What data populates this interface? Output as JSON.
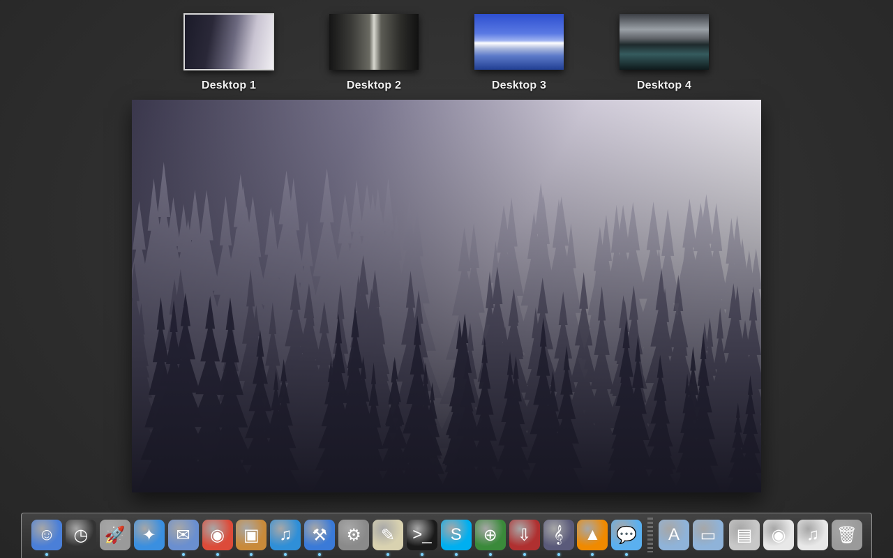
{
  "spaces": [
    {
      "label": "Desktop 1",
      "scene": "forest",
      "active": true
    },
    {
      "label": "Desktop 2",
      "scene": "canyon",
      "active": false
    },
    {
      "label": "Desktop 3",
      "scene": "glacier",
      "active": false
    },
    {
      "label": "Desktop 4",
      "scene": "mountain",
      "active": false
    }
  ],
  "dock": {
    "apps": [
      {
        "name": "finder-icon",
        "glyph": "☺",
        "color": "#4a7fd8",
        "running": true
      },
      {
        "name": "dashboard-icon",
        "glyph": "◷",
        "color": "#333333",
        "running": false
      },
      {
        "name": "launchpad-icon",
        "glyph": "🚀",
        "color": "#9a9a9a",
        "running": false
      },
      {
        "name": "safari-icon",
        "glyph": "✦",
        "color": "#3a8fe0",
        "running": false
      },
      {
        "name": "mail-icon",
        "glyph": "✉",
        "color": "#6a8fd0",
        "running": true
      },
      {
        "name": "chrome-icon",
        "glyph": "◉",
        "color": "#dd4b39",
        "running": true
      },
      {
        "name": "preview-icon",
        "glyph": "▣",
        "color": "#c98a3a",
        "running": true
      },
      {
        "name": "itunes-icon",
        "glyph": "♫",
        "color": "#2f8fd8",
        "running": true
      },
      {
        "name": "xcode-icon",
        "glyph": "⚒",
        "color": "#3a7ad8",
        "running": true
      },
      {
        "name": "system-preferences-icon",
        "glyph": "⚙",
        "color": "#8a8a8a",
        "running": false
      },
      {
        "name": "textedit-icon",
        "glyph": "✎",
        "color": "#d9d2b0",
        "running": true
      },
      {
        "name": "terminal-icon",
        "glyph": ">_",
        "color": "#1a1a1a",
        "running": true
      },
      {
        "name": "skype-icon",
        "glyph": "S",
        "color": "#00aff0",
        "running": true
      },
      {
        "name": "network-globe-icon",
        "glyph": "⊕",
        "color": "#3a8a3a",
        "running": true
      },
      {
        "name": "installer-icon",
        "glyph": "⇩",
        "color": "#b03030",
        "running": true
      },
      {
        "name": "sheet-music-icon",
        "glyph": "𝄞",
        "color": "#5a5a7a",
        "running": true
      },
      {
        "name": "vlc-icon",
        "glyph": "▲",
        "color": "#f08a00",
        "running": true
      },
      {
        "name": "messages-icon",
        "glyph": "💬",
        "color": "#5ab0f0",
        "running": true
      }
    ],
    "stacks": [
      {
        "name": "applications-folder-icon",
        "glyph": "A",
        "color": "#8fb3d9"
      },
      {
        "name": "documents-folder-icon",
        "glyph": "▭",
        "color": "#8fb3d9"
      },
      {
        "name": "server-document-icon",
        "glyph": "▤",
        "color": "#c8c8c8"
      },
      {
        "name": "chrome-window-stack-icon",
        "glyph": "◉",
        "color": "#e8e8e8"
      },
      {
        "name": "itunes-window-stack-icon",
        "glyph": "♫",
        "color": "#e8e8e8"
      },
      {
        "name": "trash-icon",
        "glyph": "🗑",
        "color": "#9a9a9a"
      }
    ]
  }
}
